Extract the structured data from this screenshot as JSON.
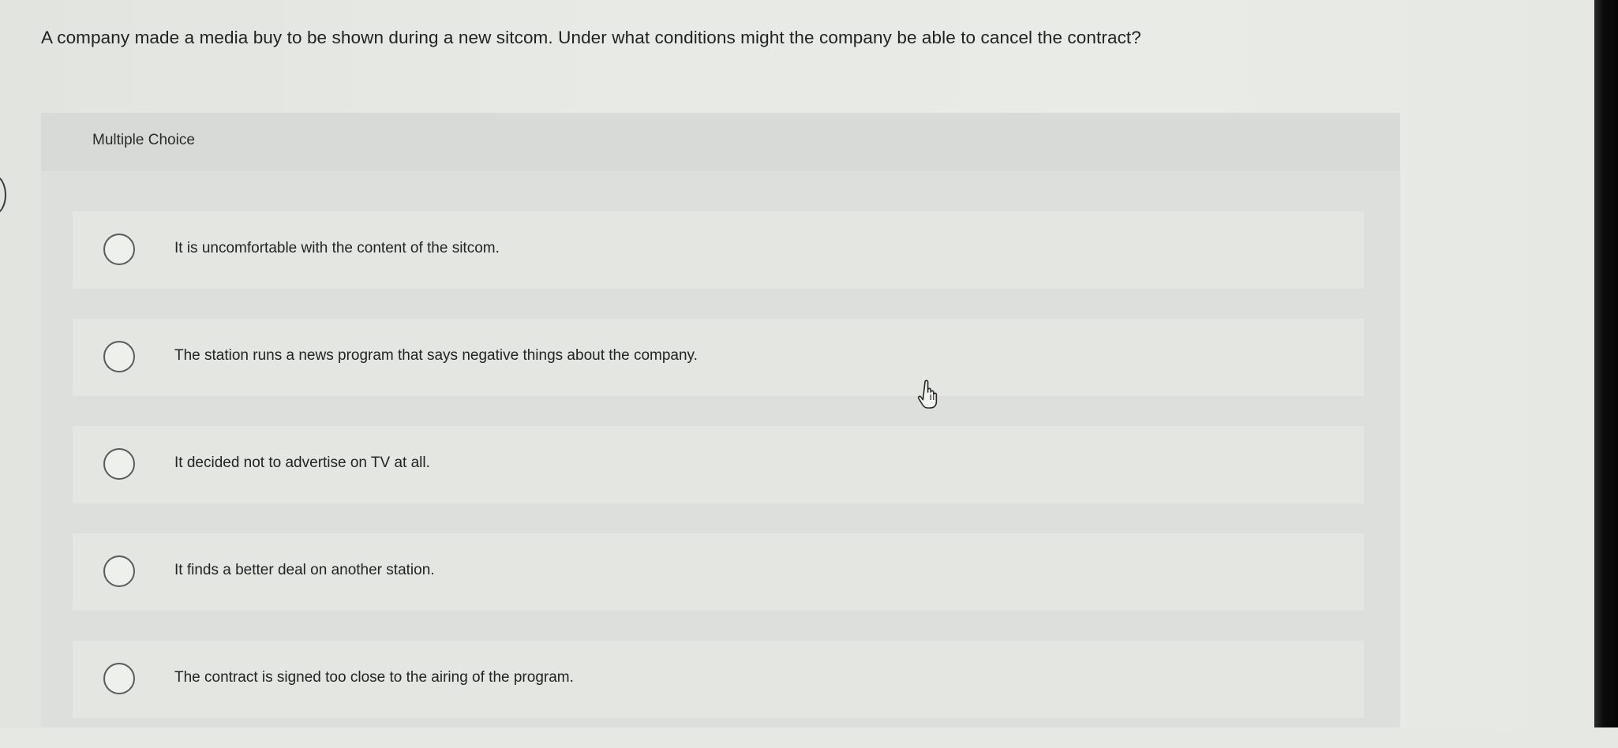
{
  "question": {
    "text": "A company made a media buy to be shown during a new sitcom. Under what conditions might the company be able to cancel the contract?"
  },
  "multiple_choice": {
    "title": "Multiple Choice",
    "options": [
      {
        "label": "It is uncomfortable with the content of the sitcom.",
        "selected": false
      },
      {
        "label": "The station runs a news program that says negative things about the company.",
        "selected": false
      },
      {
        "label": "It decided not to advertise on TV at all.",
        "selected": false
      },
      {
        "label": "It finds a better deal on another station.",
        "selected": false
      },
      {
        "label": "The contract is signed too close to the airing of the program.",
        "selected": false
      }
    ]
  },
  "cursor": {
    "icon": "hand-pointer-icon"
  },
  "colors": {
    "background": "#e6e8e4",
    "panel": "#dcdfdb",
    "option_background": "#e4e6e2",
    "radio_border": "#5a5a5a"
  }
}
